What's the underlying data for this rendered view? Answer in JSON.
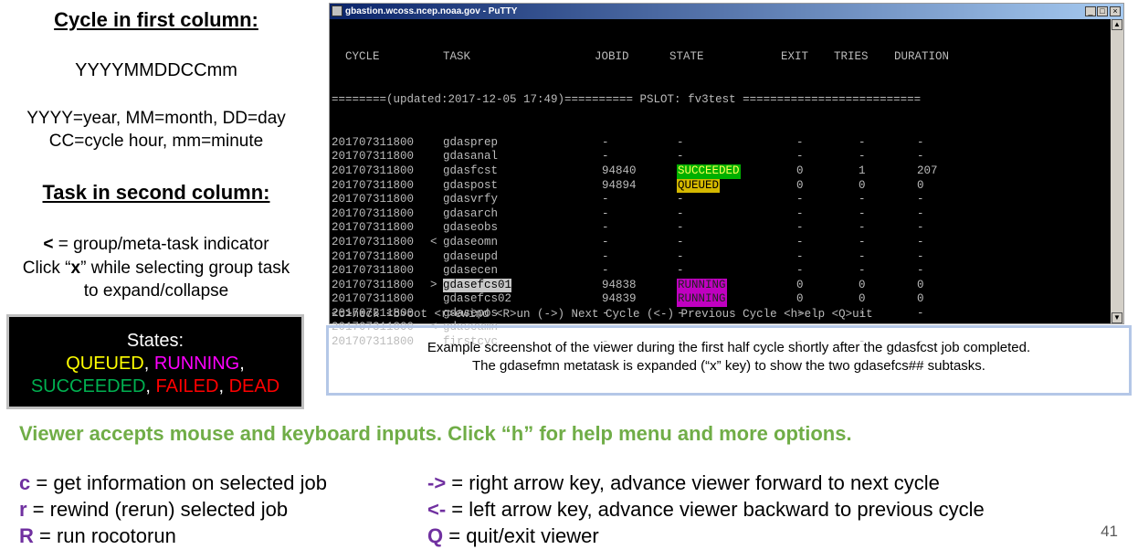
{
  "left": {
    "heading1": "Cycle in first column:",
    "format": "YYYYMMDDCCmm",
    "line1": "YYYY=year, MM=month, DD=day",
    "line2": "CC=cycle hour, mm=minute",
    "heading2": "Task in second column:",
    "indicator_sym": "<",
    "indicator_text": " = group/meta-task indicator",
    "click_pre": "Click “",
    "click_key": "x",
    "click_post": "” while selecting group task",
    "click_line2": "to expand/collapse"
  },
  "states": {
    "title": "States:",
    "items": [
      {
        "label": "QUEUED",
        "color": "#ffff00"
      },
      {
        "label": "RUNNING",
        "color": "#ff00ff"
      },
      {
        "label": "SUCCEEDED",
        "color": "#00b050"
      },
      {
        "label": "FAILED",
        "color": "#ff0000"
      },
      {
        "label": "DEAD",
        "color": "#ff0000"
      }
    ]
  },
  "window": {
    "title": "gbastion.wcoss.ncep.noaa.gov - PuTTY",
    "headers": {
      "cycle": "CYCLE",
      "task": "TASK",
      "jobid": "JOBID",
      "state": "STATE",
      "exit": "EXIT",
      "tries": "TRIES",
      "duration": "DURATION"
    },
    "status_line": "========(updated:2017-12-05 17:49)========== PSLOT: fv3test ==========================",
    "rows": [
      {
        "cycle": "201707311800",
        "ind": "",
        "task": "gdasprep",
        "jobid": "-",
        "state": "-",
        "exit": "-",
        "tries": "-",
        "duration": "-"
      },
      {
        "cycle": "201707311800",
        "ind": "",
        "task": "gdasanal",
        "jobid": "-",
        "state": "-",
        "exit": "-",
        "tries": "-",
        "duration": "-"
      },
      {
        "cycle": "201707311800",
        "ind": "",
        "task": "gdasfcst",
        "jobid": "94840",
        "state": "SUCCEEDED",
        "exit": "0",
        "tries": "1",
        "duration": "207"
      },
      {
        "cycle": "201707311800",
        "ind": "",
        "task": "gdaspost",
        "jobid": "94894",
        "state": "QUEUED",
        "exit": "0",
        "tries": "0",
        "duration": "0"
      },
      {
        "cycle": "201707311800",
        "ind": "",
        "task": "gdasvrfy",
        "jobid": "-",
        "state": "-",
        "exit": "-",
        "tries": "-",
        "duration": "-"
      },
      {
        "cycle": "201707311800",
        "ind": "",
        "task": "gdasarch",
        "jobid": "-",
        "state": "-",
        "exit": "-",
        "tries": "-",
        "duration": "-"
      },
      {
        "cycle": "201707311800",
        "ind": "",
        "task": "gdaseobs",
        "jobid": "-",
        "state": "-",
        "exit": "-",
        "tries": "-",
        "duration": "-"
      },
      {
        "cycle": "201707311800",
        "ind": "<",
        "task": "gdaseomn",
        "jobid": "-",
        "state": "-",
        "exit": "-",
        "tries": "-",
        "duration": "-"
      },
      {
        "cycle": "201707311800",
        "ind": "",
        "task": "gdaseupd",
        "jobid": "-",
        "state": "-",
        "exit": "-",
        "tries": "-",
        "duration": "-"
      },
      {
        "cycle": "201707311800",
        "ind": "",
        "task": "gdasecen",
        "jobid": "-",
        "state": "-",
        "exit": "-",
        "tries": "-",
        "duration": "-"
      },
      {
        "cycle": "201707311800",
        "ind": ">",
        "task": "gdasefcs01",
        "jobid": "94838",
        "state": "RUNNING",
        "exit": "0",
        "tries": "0",
        "duration": "0",
        "selected": true
      },
      {
        "cycle": "201707311800",
        "ind": "",
        "task": "gdasefcs02",
        "jobid": "94839",
        "state": "RUNNING",
        "exit": "0",
        "tries": "0",
        "duration": "0"
      },
      {
        "cycle": "201707311800",
        "ind": "",
        "task": "gdasepos",
        "jobid": "-",
        "state": "-",
        "exit": "-",
        "tries": "-",
        "duration": "-"
      },
      {
        "cycle": "201707311800",
        "ind": "<",
        "task": "gdaseamn",
        "jobid": "-",
        "state": "-",
        "exit": "-",
        "tries": "-",
        "duration": "-"
      },
      {
        "cycle": "201707311800",
        "ind": "",
        "task": "firstcyc",
        "jobid": "-",
        "state": "-",
        "exit": "-",
        "tries": "-",
        "duration": "-"
      }
    ],
    "footer": "<c>heck <b>oot <r>ewind <R>un (->) Next Cycle (<-) Previous Cycle <h>elp <Q>uit"
  },
  "caption": {
    "line1": "Example screenshot of the viewer during the first half cycle shortly after the gdasfcst job completed.",
    "line2": "The gdasefmn metatask is expanded (“x” key) to show the two gdasefcs## subtasks."
  },
  "green_line": "Viewer accepts mouse and keyboard inputs. Click “h” for help menu and more options.",
  "keys_left": [
    {
      "key": "c",
      "desc": " = get information on selected job"
    },
    {
      "key": "r",
      "desc": " = rewind (rerun) selected job"
    },
    {
      "key": "R",
      "desc": " = run rocotorun"
    }
  ],
  "keys_right": [
    {
      "key": "->",
      "desc": " = right arrow key, advance viewer forward to next cycle"
    },
    {
      "key": "<-",
      "desc": " = left arrow key, advance viewer backward to previous cycle"
    },
    {
      "key": "Q",
      "desc": " = quit/exit viewer"
    }
  ],
  "page_number": "41"
}
